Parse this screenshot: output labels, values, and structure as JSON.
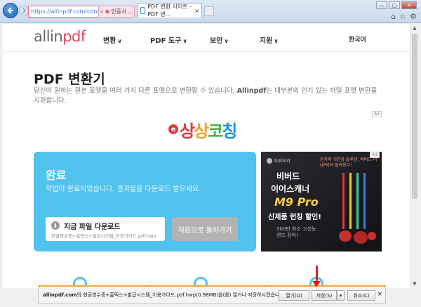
{
  "browser": {
    "address_url": "https://allinpdf.com/conv",
    "tab_other_label": "인증서 ...",
    "tab_active_label": "PDF 변환 사이트 - PDF 변...",
    "toolbar_icons": [
      "home-icon",
      "star-icon",
      "gear-icon"
    ]
  },
  "header": {
    "logo_main": "allin",
    "logo_accent": "pdf",
    "menu": [
      "변환",
      "PDF 도구",
      "보안",
      "지원"
    ],
    "chevron": "∨",
    "language": "한국어"
  },
  "main": {
    "title": "PDF 변환기",
    "description_pre": "당신이 원하는 원본 포맷을 여러 가지 다른 포맷으로 변환할 수 있습니다. ",
    "description_brand": "Allinpdf",
    "description_post": "는 대부분의 인기 있는 파일 포맷 변환을 지원합니다.",
    "ad_label": "Ad",
    "banner_prefix": "e",
    "banner_text": "상상코칭"
  },
  "result": {
    "title": "완료",
    "message": "작업이 완료되었습니다. 결과물을 다운로드 받으세요.",
    "download_label": "지금 파일 다운로드",
    "file_name": "현금영수증+홈택스+발급시스템_이용가이드.pdf.hwp",
    "back_label": "처음으로 돌아가기"
  },
  "side_ad": {
    "brand": "bobird",
    "tagline": "온가족 귀건강 솔루션, 비버드 더 UP되어 돌아왔다!",
    "line1": "비버드",
    "line2": "이어스캐너",
    "line3": "M9 Pro",
    "line4": "신제품 런칭 할인!",
    "line5a": "300만 화소 고성능",
    "line5b": "렌즈 장착!",
    "ad_label": "Ad"
  },
  "download_bar": {
    "site": "allinpdf.com",
    "message_pre": "의 ",
    "file": "현금영수증+홈택스+발급시스템_이용가이드.pdf.hwp",
    "message_post": "(0.98MB)을(를) 열거나 저장하시겠습니까?",
    "open_label": "열기(O)",
    "save_label": "저장(S)",
    "cancel_label": "취소(C)",
    "dropdown_glyph": "▾",
    "close_glyph": "×"
  },
  "colors": {
    "card": "#52c2ee",
    "logo_accent": "#e3455c",
    "arrow": "#e0201f",
    "download_bar_accent": "#f0a53a"
  }
}
